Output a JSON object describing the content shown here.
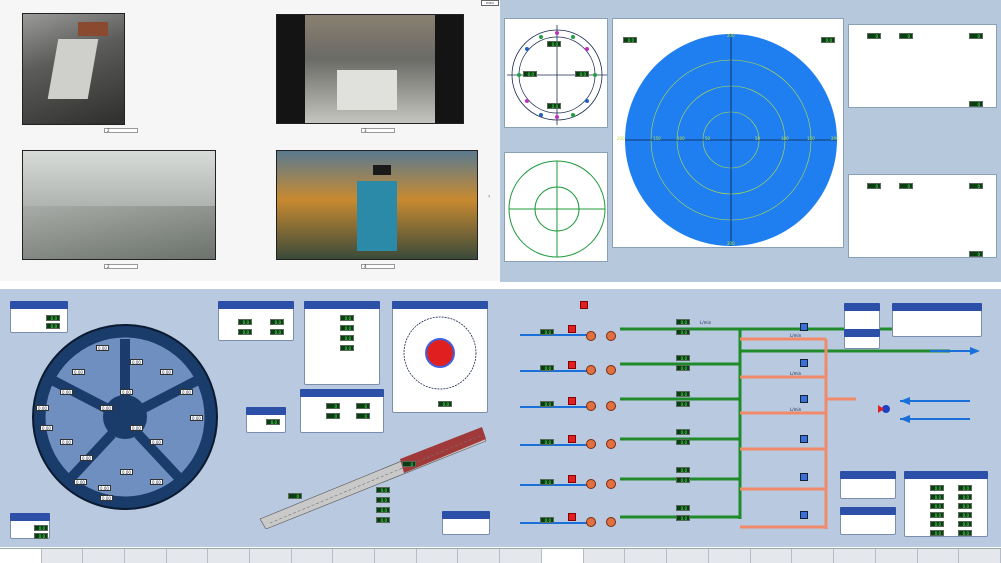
{
  "cameras": {
    "feeds": [
      {
        "selector": "2"
      },
      {
        "selector": "3"
      },
      {
        "selector": "2"
      },
      {
        "selector": "4"
      }
    ]
  },
  "steering": {
    "axis_values": {
      "top": "200",
      "bottom": "200",
      "left": "200",
      "right": "200"
    },
    "ring_labels": [
      "150",
      "100",
      "50",
      "50",
      "100",
      "150"
    ],
    "gauge_values": [
      "0.0",
      "0.0",
      "0.0",
      "0.0",
      "0.0",
      "0.0",
      "0.0",
      "0.0"
    ],
    "right_top_values": [
      "0",
      "0",
      "0",
      "0"
    ],
    "right_bottom_values": [
      "0",
      "0",
      "0",
      "0"
    ]
  },
  "cutterhead": {
    "cutter_values": [
      "0.00",
      "0.00",
      "0.00",
      "0.00",
      "0.00",
      "0.00",
      "0.00",
      "0.00",
      "0.00",
      "0.00",
      "0.00",
      "0.00",
      "0.00",
      "0.00",
      "0.00",
      "0.00",
      "0.00",
      "0.00",
      "0.00",
      "0.00"
    ],
    "torque_values": [
      "0.0",
      "0.0"
    ],
    "speed_values": [
      "0.0",
      "0.0",
      "0.0",
      "0.0",
      "0.0",
      "0.0",
      "0.0",
      "0.0"
    ],
    "units": [
      "bar",
      "bar",
      "bar",
      "bar",
      "bar",
      "bar"
    ],
    "small_values": [
      "0",
      "0",
      "0",
      "0",
      "0",
      "0"
    ],
    "bottom_values": [
      "0.0",
      "0.0"
    ],
    "screw_values": [
      "0.0",
      "0.0",
      "0.0",
      "0.0",
      "0.0",
      "0.0"
    ]
  },
  "slurry": {
    "flow_unit": "L/min",
    "line_values": [
      "0.0",
      "0.0",
      "0.0",
      "0.0",
      "0.0",
      "0.0",
      "0.0",
      "0.0",
      "0.0",
      "0.0",
      "0.0",
      "0.0"
    ],
    "side_values": [
      "0.0",
      "0.0",
      "0.0",
      "0.0",
      "0.0",
      "0.0"
    ],
    "table_values": [
      "0.0",
      "0.0",
      "0.0",
      "0.0",
      "0.0",
      "0.0",
      "0.0",
      "0.0",
      "0.0",
      "0.0",
      "0.0",
      "0.0"
    ],
    "colors": {
      "pipe_green": "#1e8a2a",
      "pipe_orange": "#f08a6a",
      "pipe_blue": "#1a6fd8"
    }
  },
  "colors": {
    "panel_bg": "#b8c9e0",
    "header_blue": "#2c4fa8",
    "value_bg": "#0b3d12",
    "value_fg": "#5cff6a",
    "plot_blue": "#1f7ff0"
  }
}
